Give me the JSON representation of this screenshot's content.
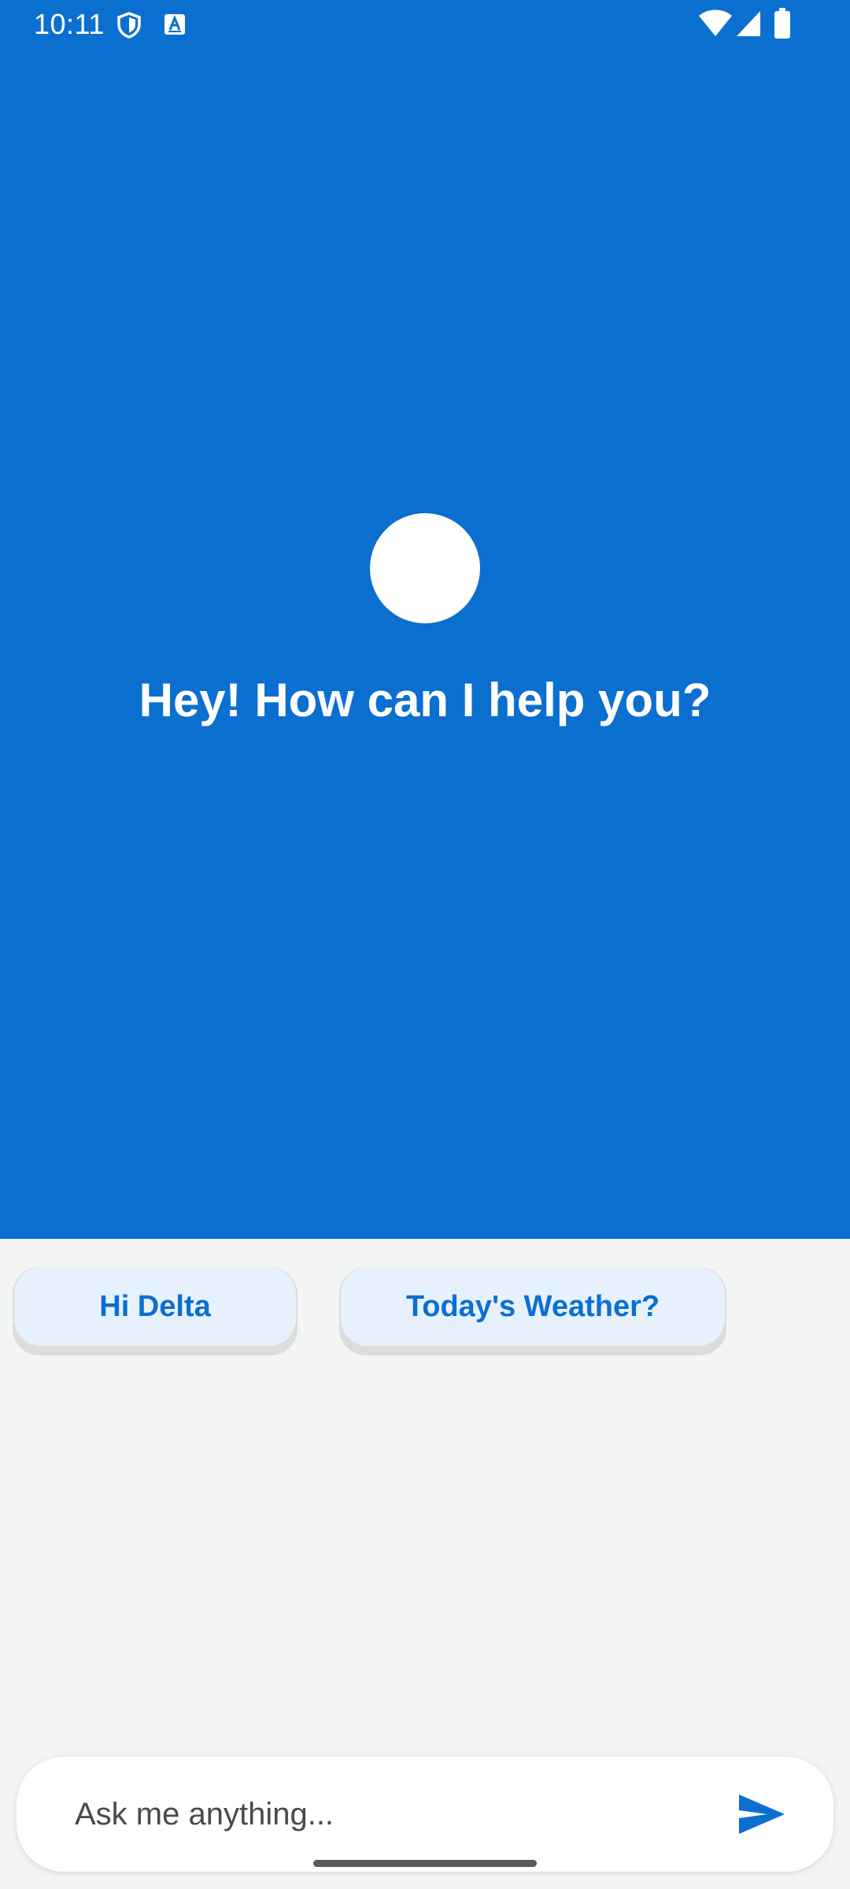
{
  "status_bar": {
    "time": "10:11",
    "icons": [
      "shield-icon",
      "font-a-icon",
      "wifi-icon",
      "signal-icon",
      "battery-icon"
    ]
  },
  "hero": {
    "background_color": "#0b6fd0",
    "greeting": "Hey! How can I help you?"
  },
  "suggestions": [
    {
      "label": "Hi Delta"
    },
    {
      "label": "Today's Weather?"
    }
  ],
  "composer": {
    "placeholder": "Ask me anything...",
    "send_icon": "send-icon"
  },
  "colors": {
    "accent": "#0b6fd0",
    "chip_background": "#e6f1fd",
    "page_background": "#f3f5f4"
  }
}
